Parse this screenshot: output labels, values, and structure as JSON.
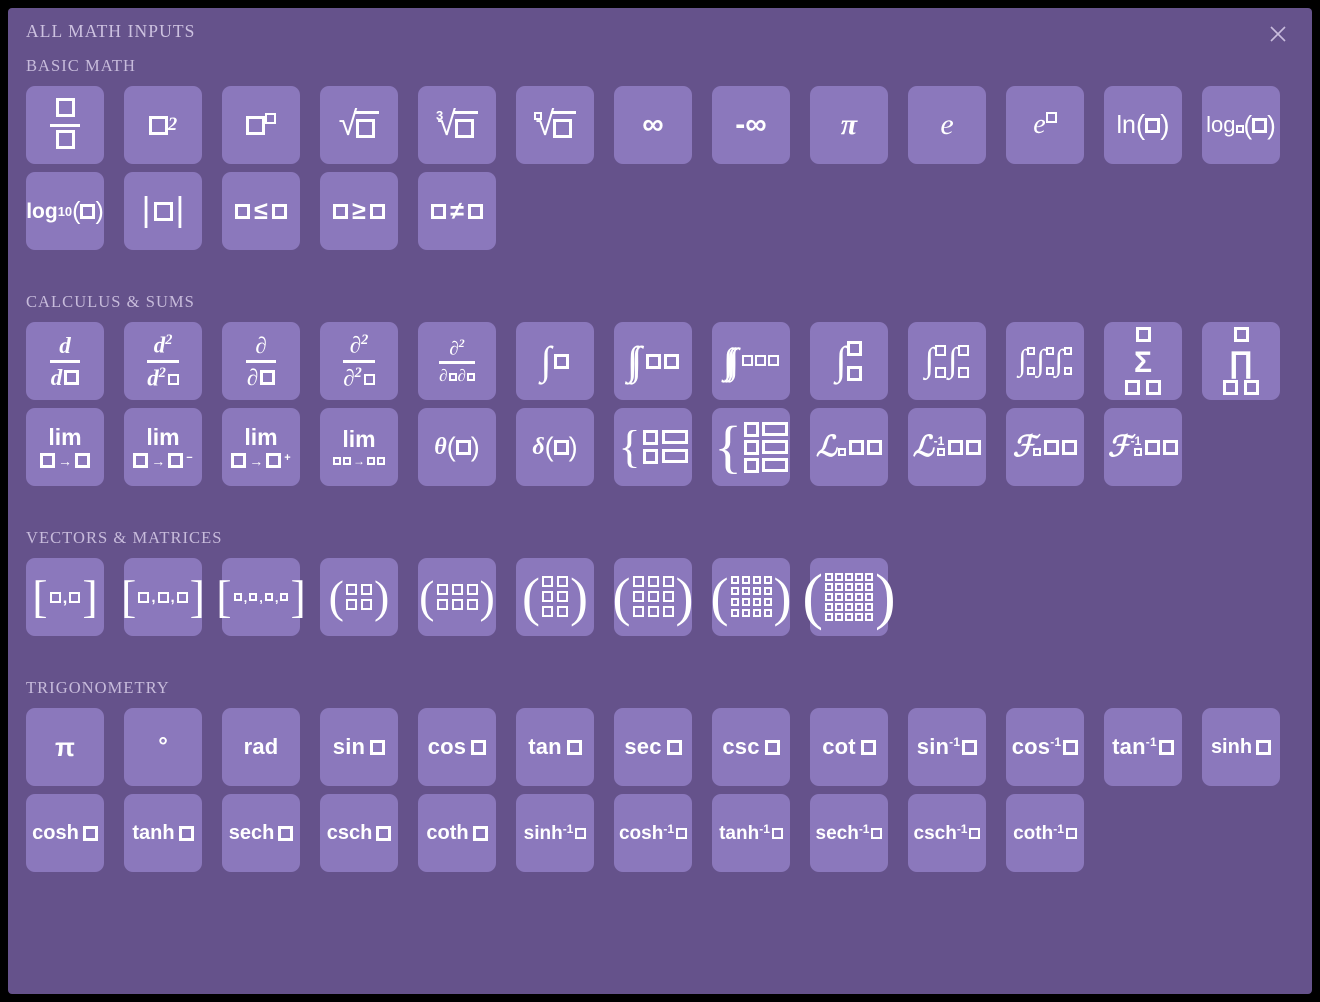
{
  "panel": {
    "title": "ALL MATH INPUTS",
    "close_icon": "close-icon",
    "accent_bg": "#65528b",
    "button_bg": "#8b78bc",
    "text_color": "#ffffff",
    "label_color": "#c7bbdb"
  },
  "sections": [
    {
      "id": "basic-math",
      "title": "BASIC MATH",
      "rows": [
        [
          {
            "id": "fraction",
            "label": "□/□"
          },
          {
            "id": "square",
            "label": "□²"
          },
          {
            "id": "power",
            "label": "□^□"
          },
          {
            "id": "sqrt",
            "label": "√□"
          },
          {
            "id": "cbrt",
            "label": "∛□",
            "index": "3"
          },
          {
            "id": "nthroot",
            "label": "ⁿ√□",
            "index": "□"
          },
          {
            "id": "infinity",
            "label": "∞"
          },
          {
            "id": "neg-infinity",
            "label": "-∞"
          },
          {
            "id": "pi",
            "label": "π"
          },
          {
            "id": "e",
            "label": "e"
          },
          {
            "id": "e-power",
            "label": "e^□"
          },
          {
            "id": "ln",
            "label": "ln(□)"
          },
          {
            "id": "log-base",
            "label": "log_□(□)"
          }
        ],
        [
          {
            "id": "log10",
            "label": "log₁₀(□)"
          },
          {
            "id": "abs",
            "label": "|□|"
          },
          {
            "id": "leq",
            "label": "□ ≤ □"
          },
          {
            "id": "geq",
            "label": "□ ≥ □"
          },
          {
            "id": "neq",
            "label": "□ ≠ □"
          }
        ]
      ]
    },
    {
      "id": "calculus-sums",
      "title": "CALCULUS & SUMS",
      "rows": [
        [
          {
            "id": "derivative",
            "label": "d/d□"
          },
          {
            "id": "second-derivative",
            "label": "d²/d²□"
          },
          {
            "id": "partial-derivative",
            "label": "∂/∂□"
          },
          {
            "id": "second-partial-derivative",
            "label": "∂²/∂²□"
          },
          {
            "id": "mixed-partial-derivative",
            "label": "∂²/∂□∂□"
          },
          {
            "id": "integral",
            "label": "∫□"
          },
          {
            "id": "double-integral",
            "label": "∬□□"
          },
          {
            "id": "triple-integral",
            "label": "∭□□□"
          },
          {
            "id": "definite-integral",
            "label": "∫_□^□"
          },
          {
            "id": "double-definite-integral",
            "label": "∫_□^□∫_□^□"
          },
          {
            "id": "triple-definite-integral",
            "label": "∫_□^□∫_□^□∫_□^□"
          },
          {
            "id": "summation",
            "label": "Σ"
          },
          {
            "id": "product",
            "label": "∏"
          }
        ],
        [
          {
            "id": "limit",
            "label": "lim □→□"
          },
          {
            "id": "limit-left",
            "label": "lim □→□⁻"
          },
          {
            "id": "limit-right",
            "label": "lim □→□⁺"
          },
          {
            "id": "limit-multivar",
            "label": "lim □□→□□"
          },
          {
            "id": "heaviside-theta",
            "label": "θ(□)"
          },
          {
            "id": "dirac-delta",
            "label": "δ(□)"
          },
          {
            "id": "piecewise-2",
            "label": "{ 2×2 }"
          },
          {
            "id": "piecewise-3",
            "label": "{ 3×2 }"
          },
          {
            "id": "laplace",
            "label": "ℒ_□□□"
          },
          {
            "id": "inverse-laplace",
            "label": "ℒ⁻¹_□□□"
          },
          {
            "id": "fourier",
            "label": "ℱ_□□□"
          },
          {
            "id": "inverse-fourier",
            "label": "ℱ⁻¹_□□□"
          }
        ]
      ]
    },
    {
      "id": "vectors-matrices",
      "title": "VECTORS & MATRICES",
      "rows": [
        [
          {
            "id": "vector-2",
            "label": "[□,□]"
          },
          {
            "id": "vector-3",
            "label": "[□,□,□]"
          },
          {
            "id": "vector-4",
            "label": "[□,□,□,□]"
          },
          {
            "id": "matrix-2x2",
            "label": "(2×2)"
          },
          {
            "id": "matrix-2x3",
            "label": "(2×3)"
          },
          {
            "id": "matrix-3x2",
            "label": "(3×2)"
          },
          {
            "id": "matrix-3x3",
            "label": "(3×3)"
          },
          {
            "id": "matrix-4x4",
            "label": "(4×4)"
          },
          {
            "id": "matrix-5x5",
            "label": "(5×5)"
          }
        ]
      ]
    },
    {
      "id": "trigonometry",
      "title": "TRIGONOMETRY",
      "rows": [
        [
          {
            "id": "trig-pi",
            "label": "π"
          },
          {
            "id": "degree",
            "label": "°"
          },
          {
            "id": "rad",
            "label": "rad"
          },
          {
            "id": "sin",
            "label": "sin □"
          },
          {
            "id": "cos",
            "label": "cos □"
          },
          {
            "id": "tan",
            "label": "tan □"
          },
          {
            "id": "sec",
            "label": "sec □"
          },
          {
            "id": "csc",
            "label": "csc □"
          },
          {
            "id": "cot",
            "label": "cot □"
          },
          {
            "id": "asin",
            "label": "sin⁻¹ □"
          },
          {
            "id": "acos",
            "label": "cos⁻¹ □"
          },
          {
            "id": "atan",
            "label": "tan⁻¹ □"
          },
          {
            "id": "sinh",
            "label": "sinh □"
          }
        ],
        [
          {
            "id": "cosh",
            "label": "cosh □"
          },
          {
            "id": "tanh",
            "label": "tanh □"
          },
          {
            "id": "sech",
            "label": "sech □"
          },
          {
            "id": "csch",
            "label": "csch □"
          },
          {
            "id": "coth",
            "label": "coth □"
          },
          {
            "id": "asinh",
            "label": "sinh⁻¹ □"
          },
          {
            "id": "acosh",
            "label": "cosh⁻¹ □"
          },
          {
            "id": "atanh",
            "label": "tanh⁻¹ □"
          },
          {
            "id": "asech",
            "label": "sech⁻¹ □"
          },
          {
            "id": "acsch",
            "label": "csch⁻¹ □"
          },
          {
            "id": "acoth",
            "label": "coth⁻¹ □"
          }
        ]
      ]
    }
  ],
  "trig_text": {
    "pi": "π",
    "degree": "°",
    "rad": "rad",
    "sin": "sin",
    "cos": "cos",
    "tan": "tan",
    "sec": "sec",
    "csc": "csc",
    "cot": "cot",
    "sinh": "sinh",
    "cosh": "cosh",
    "tanh": "tanh",
    "sech": "sech",
    "csch": "csch",
    "coth": "coth",
    "inv": "-1"
  },
  "glyphs": {
    "infinity": "∞",
    "neg_infinity": "-∞",
    "pi": "π",
    "e": "e",
    "ln": "ln",
    "log": "log",
    "log_base_sub": "10",
    "leq": "≤",
    "geq": "≥",
    "neq": "≠",
    "d": "d",
    "partial": "∂",
    "two": "2",
    "three": "3",
    "integral": "∫",
    "sigma": "Σ",
    "pi_product": "∏",
    "lim": "lim",
    "arrow": "→",
    "minus": "−",
    "plus": "+",
    "theta": "θ",
    "delta": "δ",
    "laplace": "ℒ",
    "fourier": "ℱ",
    "lparen": "(",
    "rparen": ")",
    "lbracket": "[",
    "rbracket": "]",
    "lbrace": "{",
    "comma": ",",
    "vbar": "|"
  }
}
